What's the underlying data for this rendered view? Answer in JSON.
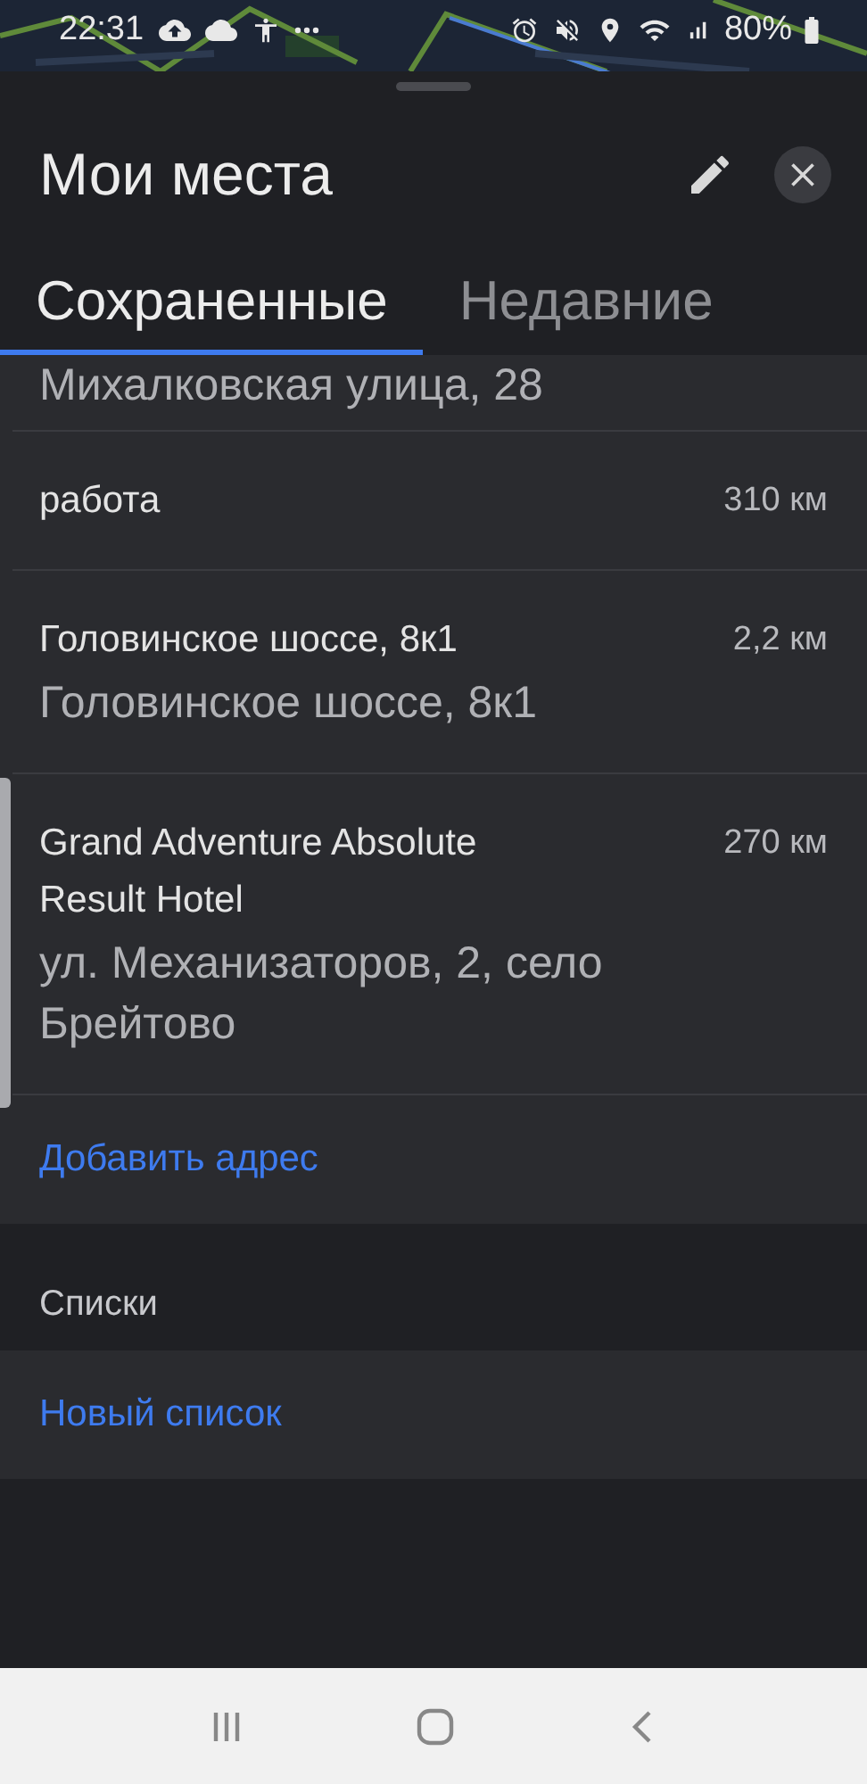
{
  "status_bar": {
    "time": "22:31",
    "battery": "80%"
  },
  "sheet": {
    "title": "Мои места"
  },
  "tabs": [
    {
      "label": "Сохраненные",
      "selected": true
    },
    {
      "label": "Недавние",
      "selected": false
    }
  ],
  "places": [
    {
      "subtitle": "Михалковская улица, 28"
    },
    {
      "name": "работа",
      "distance": "310 км"
    },
    {
      "name": "Головинское шоссе, 8к1",
      "distance": "2,2 км",
      "subtitle": "Головинское шоссе, 8к1"
    },
    {
      "name": "Grand Adventure Absolute Result Hotel",
      "distance": "270 км",
      "subtitle": "ул. Механизаторов, 2, село Брейтово"
    }
  ],
  "add_address": "Добавить адрес",
  "lists": {
    "heading": "Списки",
    "new_list": "Новый список"
  }
}
